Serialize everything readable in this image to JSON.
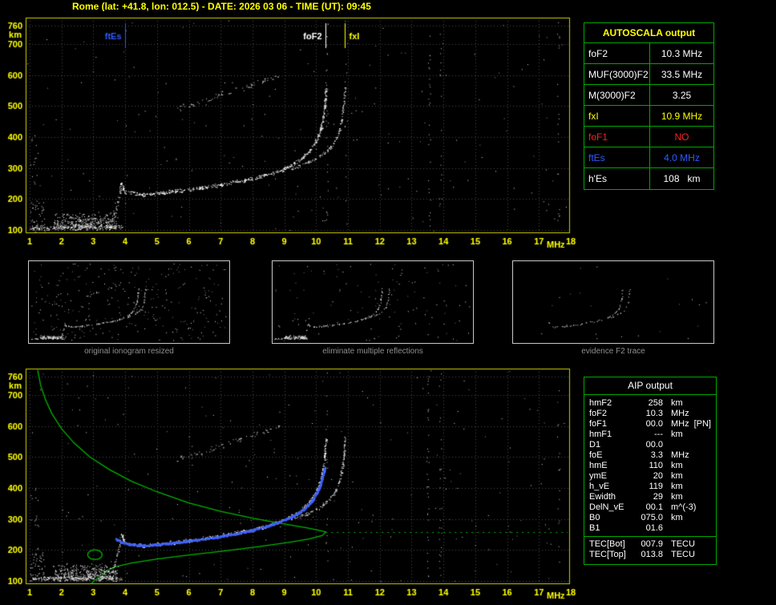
{
  "header": {
    "title": "Rome (lat: +41.8, lon: 012.5) - DATE: 2026 03 06 - TIME (UT): 09:45"
  },
  "colors": {
    "background": "#000000",
    "yellow": "#ffff00",
    "green": "#00a800",
    "profile_green": "#00b400",
    "red": "#ff2020",
    "blue": "#2e5bff",
    "white": "#ffffff",
    "grid": "#4a4a4a",
    "plot_border": "#cccc00",
    "caption_gray": "#8f8f8f",
    "thumb_border": "#c8c8c8"
  },
  "autoscala_table": {
    "title": "AUTOSCALA output",
    "rows": [
      {
        "label": "foF2",
        "value": "10.3 MHz",
        "color": "#ffffff"
      },
      {
        "label": "MUF(3000)F2",
        "value": "33.5 MHz",
        "color": "#ffffff"
      },
      {
        "label": "M(3000)F2",
        "value": "3.25",
        "color": "#ffffff"
      },
      {
        "label": "fxI",
        "value": "10.9 MHz",
        "color": "#ffff00"
      },
      {
        "label": "foF1",
        "value": "NO",
        "color": "#ff2020"
      },
      {
        "label": "ftEs",
        "value": "4.0 MHz",
        "color": "#2e5bff"
      },
      {
        "label": "h'Es",
        "value": "108   km",
        "color": "#ffffff"
      }
    ]
  },
  "aip_table": {
    "title": "AIP output",
    "rows": [
      {
        "label": "hmF2",
        "value": "258",
        "unit": "km",
        "extra": ""
      },
      {
        "label": "foF2",
        "value": "10.3",
        "unit": "MHz",
        "extra": ""
      },
      {
        "label": "foF1",
        "value": "00.0",
        "unit": "MHz",
        "extra": "[PN]"
      },
      {
        "label": "hmF1",
        "value": "---",
        "unit": "km",
        "extra": ""
      },
      {
        "label": "D1",
        "value": "00.0",
        "unit": "",
        "extra": ""
      },
      {
        "label": "foE",
        "value": "3.3",
        "unit": "MHz",
        "extra": ""
      },
      {
        "label": "hmE",
        "value": "110",
        "unit": "km",
        "extra": ""
      },
      {
        "label": "ymE",
        "value": "20",
        "unit": "km",
        "extra": ""
      },
      {
        "label": "h_vE",
        "value": "119",
        "unit": "km",
        "extra": ""
      },
      {
        "label": "Ewidth",
        "value": "29",
        "unit": "km",
        "extra": ""
      },
      {
        "label": "DelN_vE",
        "value": "00.1",
        "unit": "m^(-3)",
        "extra": ""
      },
      {
        "label": "B0",
        "value": "075.0",
        "unit": "km",
        "extra": ""
      },
      {
        "label": "B1",
        "value": "01.6",
        "unit": "",
        "extra": ""
      },
      {
        "label": "TEC[Bot]",
        "value": "007.9",
        "unit": "TECU",
        "extra": ""
      },
      {
        "label": "TEC[Top]",
        "value": "013.8",
        "unit": "TECU",
        "extra": ""
      }
    ]
  },
  "thumbnails": [
    {
      "caption": "original ionogram resized"
    },
    {
      "caption": "eliminate multiple reflections"
    },
    {
      "caption": "evidence F2 trace"
    }
  ],
  "chart_data": [
    {
      "id": "top_ionogram",
      "type": "scatter",
      "title": "ionogram with AUTOSCALA markers",
      "xlabel": "MHz",
      "ylabel": "km",
      "xlim": [
        1,
        18
      ],
      "ylim": [
        92,
        785
      ],
      "xticks": [
        1,
        2,
        3,
        4,
        5,
        6,
        7,
        8,
        9,
        10,
        11,
        12,
        13,
        14,
        15,
        16,
        17,
        18
      ],
      "yticks": [
        100,
        200,
        300,
        400,
        500,
        600,
        700,
        760
      ],
      "grid": true,
      "markers": [
        {
          "name": "ftEs",
          "freq": 4.0,
          "color": "#2e5bff",
          "side": "left"
        },
        {
          "name": "foF2",
          "freq": 10.3,
          "color": "#ffffff",
          "side": "left"
        },
        {
          "name": "fxI",
          "freq": 10.9,
          "color": "#ffff00",
          "side": "right"
        }
      ],
      "series": [
        {
          "name": "Es-trace",
          "color": "#f2f2f2",
          "spread": 2,
          "density": 1.8,
          "points": [
            [
              1.0,
              107
            ],
            [
              2.0,
              108
            ],
            [
              3.0,
              108
            ],
            [
              3.9,
              109
            ]
          ],
          "blob": {
            "from": 1.75,
            "to": 3.75,
            "base": 112,
            "spread": 11,
            "count": 420
          }
        },
        {
          "name": "EF-cusp",
          "color": "#e0e0e0",
          "spread": 3,
          "density": 0.9,
          "points": [
            [
              3.55,
              128
            ],
            [
              3.7,
              165
            ],
            [
              3.8,
              205
            ],
            [
              3.85,
              240
            ]
          ]
        },
        {
          "name": "F2-ordinary",
          "color": "#ffffff",
          "spread": 1.7,
          "density": 1.7,
          "points": [
            [
              3.85,
              255
            ],
            [
              4.0,
              222
            ],
            [
              4.6,
              214
            ],
            [
              5.2,
              221
            ],
            [
              6.0,
              231
            ],
            [
              7.0,
              246
            ],
            [
              8.0,
              266
            ],
            [
              8.6,
              283
            ],
            [
              9.1,
              303
            ],
            [
              9.5,
              326
            ],
            [
              9.8,
              356
            ],
            [
              10.0,
              390
            ],
            [
              10.15,
              430
            ],
            [
              10.22,
              468
            ],
            [
              10.27,
              512
            ],
            [
              10.3,
              558
            ]
          ]
        },
        {
          "name": "F2-extraordinary",
          "color": "#e8e8e8",
          "spread": 1.5,
          "density": 1.2,
          "points": [
            [
              9.2,
              298
            ],
            [
              9.7,
              317
            ],
            [
              10.1,
              338
            ],
            [
              10.4,
              362
            ],
            [
              10.6,
              390
            ],
            [
              10.72,
              420
            ],
            [
              10.8,
              455
            ],
            [
              10.85,
              495
            ],
            [
              10.88,
              532
            ],
            [
              10.91,
              565
            ]
          ]
        },
        {
          "name": "second-hop",
          "color": "#d0d0d0",
          "spread": 2.6,
          "density": 0.5,
          "points": [
            [
              5.6,
              490
            ],
            [
              6.4,
              515
            ],
            [
              7.2,
              545
            ],
            [
              8.0,
              572
            ],
            [
              8.8,
              600
            ]
          ]
        }
      ],
      "noise": {
        "count": 230,
        "columns": [
          10.33,
          10.93,
          13.55,
          13.9,
          17.6
        ]
      }
    },
    {
      "id": "bottom_ionogram",
      "type": "scatter",
      "title": "ionogram with AIP electron density profile",
      "xlabel": "MHz",
      "ylabel": "km",
      "xlim": [
        1,
        18
      ],
      "ylim": [
        92,
        785
      ],
      "xticks": [
        1,
        2,
        3,
        4,
        5,
        6,
        7,
        8,
        9,
        10,
        11,
        12,
        13,
        14,
        15,
        16,
        17,
        18
      ],
      "yticks": [
        100,
        200,
        300,
        400,
        500,
        600,
        700,
        760
      ],
      "grid": true,
      "series": [
        {
          "name": "Es-trace",
          "color": "#f2f2f2",
          "spread": 2,
          "density": 1.8,
          "points": [
            [
              1.0,
              107
            ],
            [
              2.0,
              108
            ],
            [
              3.0,
              108
            ],
            [
              3.9,
              109
            ]
          ],
          "blob": {
            "from": 1.75,
            "to": 3.75,
            "base": 112,
            "spread": 11,
            "count": 420
          }
        },
        {
          "name": "EF-cusp",
          "color": "#e0e0e0",
          "spread": 3,
          "density": 0.9,
          "points": [
            [
              3.55,
              128
            ],
            [
              3.7,
              165
            ],
            [
              3.8,
              205
            ],
            [
              3.85,
              240
            ]
          ]
        },
        {
          "name": "F2-ordinary",
          "color": "#ffffff",
          "spread": 1.7,
          "density": 1.7,
          "points": [
            [
              3.85,
              255
            ],
            [
              4.0,
              222
            ],
            [
              4.6,
              214
            ],
            [
              5.2,
              221
            ],
            [
              6.0,
              231
            ],
            [
              7.0,
              246
            ],
            [
              8.0,
              266
            ],
            [
              8.6,
              283
            ],
            [
              9.1,
              303
            ],
            [
              9.5,
              326
            ],
            [
              9.8,
              356
            ],
            [
              10.0,
              390
            ],
            [
              10.15,
              430
            ],
            [
              10.22,
              468
            ],
            [
              10.27,
              512
            ],
            [
              10.3,
              558
            ]
          ]
        },
        {
          "name": "F2-extraordinary",
          "color": "#e8e8e8",
          "spread": 1.5,
          "density": 1.2,
          "points": [
            [
              9.2,
              298
            ],
            [
              9.7,
              317
            ],
            [
              10.1,
              338
            ],
            [
              10.4,
              362
            ],
            [
              10.6,
              390
            ],
            [
              10.72,
              420
            ],
            [
              10.8,
              455
            ],
            [
              10.85,
              495
            ],
            [
              10.88,
              532
            ],
            [
              10.91,
              565
            ]
          ]
        },
        {
          "name": "second-hop",
          "color": "#d0d0d0",
          "spread": 2.6,
          "density": 0.5,
          "points": [
            [
              5.6,
              490
            ],
            [
              6.4,
              515
            ],
            [
              7.2,
              545
            ],
            [
              8.0,
              572
            ],
            [
              8.8,
              600
            ]
          ]
        }
      ],
      "noise": {
        "count": 260,
        "columns": [
          10.33,
          13.5,
          13.9,
          17.6
        ]
      },
      "profile": {
        "name": "electron-density-profile",
        "color": "#00b400",
        "points": [
          [
            1.25,
            782
          ],
          [
            1.35,
            730
          ],
          [
            1.5,
            685
          ],
          [
            1.7,
            640
          ],
          [
            2.0,
            592
          ],
          [
            2.4,
            545
          ],
          [
            2.9,
            500
          ],
          [
            3.5,
            460
          ],
          [
            4.2,
            422
          ],
          [
            5.0,
            388
          ],
          [
            6.0,
            352
          ],
          [
            7.0,
            325
          ],
          [
            8.0,
            303
          ],
          [
            9.0,
            284
          ],
          [
            9.7,
            272
          ],
          [
            10.15,
            262
          ],
          [
            10.3,
            258
          ],
          [
            10.2,
            247
          ],
          [
            9.8,
            236
          ],
          [
            9.1,
            224
          ],
          [
            8.2,
            211
          ],
          [
            7.1,
            197
          ],
          [
            6.0,
            184
          ],
          [
            5.0,
            171
          ],
          [
            4.2,
            158
          ],
          [
            3.7,
            146
          ],
          [
            3.45,
            135
          ],
          [
            3.35,
            127
          ],
          [
            3.3,
            119
          ],
          [
            3.25,
            113
          ],
          [
            3.1,
            106
          ],
          [
            3.0,
            99
          ],
          [
            2.95,
            92
          ]
        ],
        "peak_line": {
          "height_km": 258,
          "from": 10.3,
          "to": 17.9
        }
      },
      "fitted_trace": {
        "name": "autoscala-fitted-F2-trace",
        "color": "#3f62ff",
        "spread": 0.9,
        "density": 2.2,
        "points": [
          [
            3.7,
            238
          ],
          [
            3.9,
            225
          ],
          [
            4.4,
            216
          ],
          [
            5.0,
            219
          ],
          [
            5.8,
            228
          ],
          [
            6.8,
            242
          ],
          [
            7.8,
            261
          ],
          [
            8.6,
            283
          ],
          [
            9.2,
            307
          ],
          [
            9.6,
            332
          ],
          [
            9.9,
            365
          ],
          [
            10.1,
            405
          ],
          [
            10.2,
            440
          ],
          [
            10.26,
            470
          ]
        ]
      },
      "highlight_circle": {
        "freq": 3.05,
        "height_km": 185,
        "color": "#00c000"
      }
    }
  ]
}
